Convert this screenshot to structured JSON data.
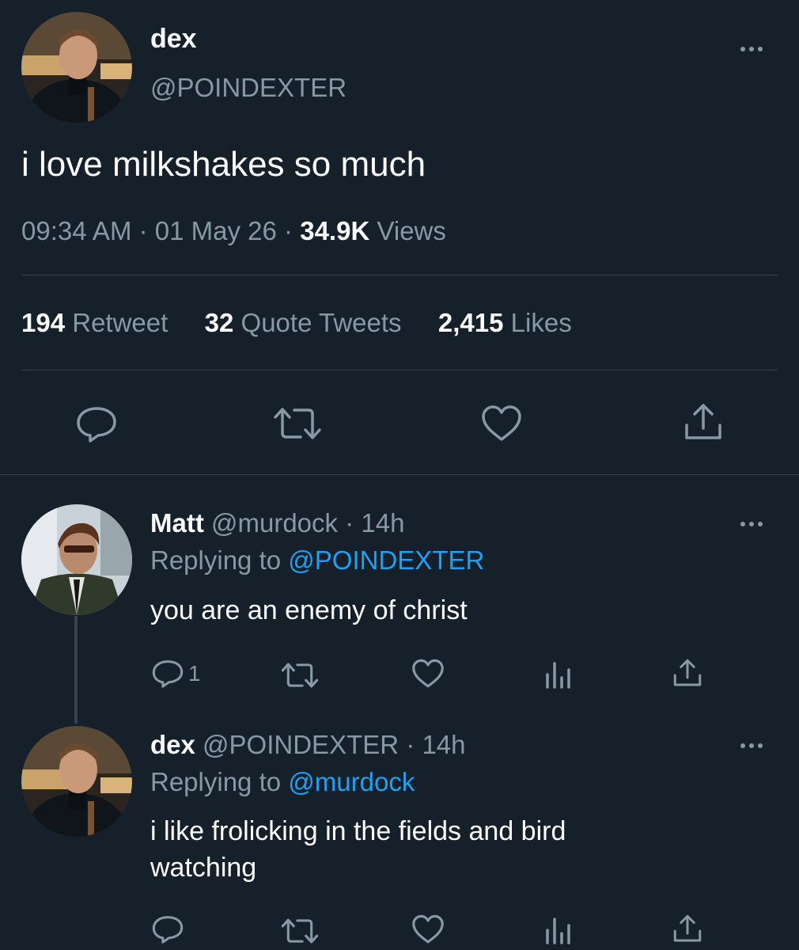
{
  "main_tweet": {
    "display_name": "dex",
    "handle": "@POINDEXTER",
    "text": "i love milkshakes so much",
    "time": "09:34 AM",
    "date": "01 May 26",
    "views_count": "34.9K",
    "views_label": "Views",
    "retweet_count": "194",
    "retweet_label": "Retweet",
    "quote_count": "32",
    "quote_label": "Quote Tweets",
    "like_count": "2,415",
    "like_label": "Likes"
  },
  "replies": [
    {
      "display_name": "Matt",
      "handle": "@murdock",
      "age": "14h",
      "replying_prefix": "Replying to",
      "replying_to": "@POINDEXTER",
      "text": "you are an enemy of christ",
      "reply_count": "1"
    },
    {
      "display_name": "dex",
      "handle": "@POINDEXTER",
      "age": "14h",
      "replying_prefix": "Replying to",
      "replying_to": "@murdock",
      "text_line1": "i like frolicking in the fields and bird",
      "text_line2": "watching"
    }
  ],
  "separator": "·",
  "colors": {
    "background": "#15202b",
    "muted": "#8899a6",
    "link": "#1da1f2",
    "divider": "#38444d"
  },
  "icons": [
    "avatar",
    "more-icon",
    "reply-icon",
    "retweet-icon",
    "like-icon",
    "share-icon",
    "analytics-icon"
  ]
}
